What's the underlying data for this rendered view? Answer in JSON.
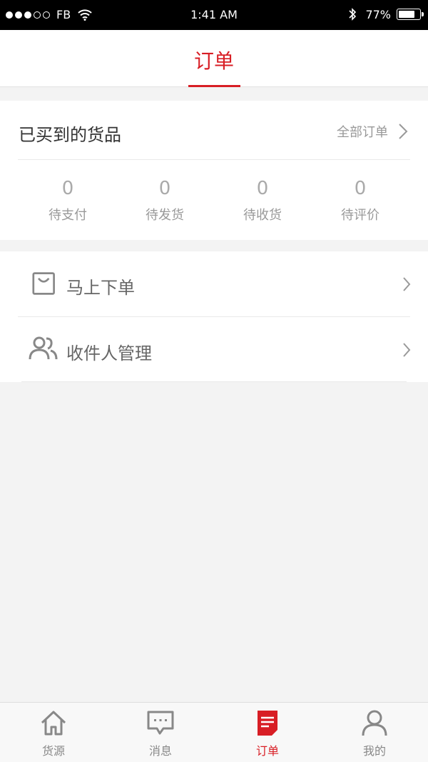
{
  "status_bar": {
    "carrier": "FB",
    "time": "1:41 AM",
    "battery": "77%",
    "battery_level": 0.77
  },
  "header": {
    "title": "订单"
  },
  "orders": {
    "title": "已买到的货品",
    "all_orders_label": "全部订单",
    "stats": [
      {
        "count": "0",
        "label": "待支付"
      },
      {
        "count": "0",
        "label": "待发货"
      },
      {
        "count": "0",
        "label": "待收货"
      },
      {
        "count": "0",
        "label": "待评价"
      }
    ]
  },
  "menu": {
    "items": [
      {
        "label": "马上下单",
        "icon": "shopping-bag-icon"
      },
      {
        "label": "收件人管理",
        "icon": "users-icon"
      }
    ]
  },
  "tabbar": {
    "active_color": "#d81e25",
    "tabs": [
      {
        "label": "货源",
        "icon": "home-icon"
      },
      {
        "label": "消息",
        "icon": "message-icon"
      },
      {
        "label": "订单",
        "icon": "order-icon",
        "active": true
      },
      {
        "label": "我的",
        "icon": "profile-icon"
      }
    ]
  }
}
